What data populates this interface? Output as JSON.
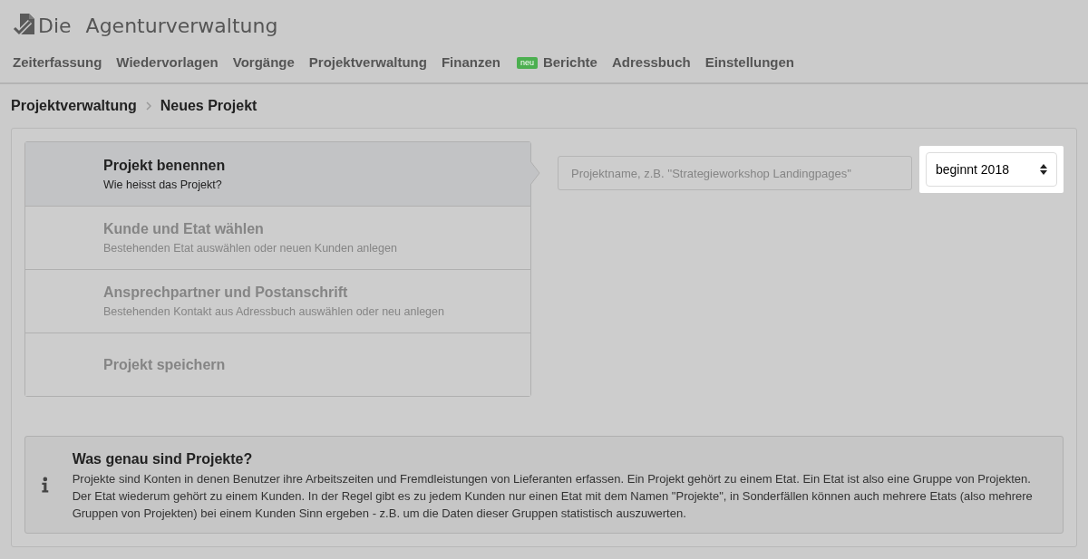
{
  "app": {
    "title_prefix": "Die",
    "title": "Agenturverwaltung"
  },
  "nav": [
    {
      "label": "Zeiterfassung"
    },
    {
      "label": "Wiedervorlagen"
    },
    {
      "label": "Vorgänge"
    },
    {
      "label": "Projektverwaltung"
    },
    {
      "label": "Finanzen"
    },
    {
      "label": "Berichte",
      "badge": "neu"
    },
    {
      "label": "Adressbuch"
    },
    {
      "label": "Einstellungen"
    }
  ],
  "breadcrumb": [
    "Projektverwaltung",
    "Neues Projekt"
  ],
  "steps": [
    {
      "title": "Projekt benennen",
      "subtitle": "Wie heisst das Projekt?",
      "selected": true
    },
    {
      "title": "Kunde und Etat wählen",
      "subtitle": "Bestehenden Etat auswählen oder neuen Kunden anlegen",
      "selected": false
    },
    {
      "title": "Ansprechpartner und Postanschrift",
      "subtitle": "Bestehenden Kontakt aus Adressbuch auswählen oder neu anlegen",
      "selected": false
    },
    {
      "title": "Projekt speichern",
      "selected": false
    }
  ],
  "name_field": {
    "placeholder": "Projektname, z.B. ''Strategieworkshop Landingpages''"
  },
  "year_select": {
    "value": "beginnt 2018"
  },
  "info": {
    "title": "Was genau sind Projekte?",
    "text": "Projekte sind Konten in denen Benutzer ihre Arbeitszeiten und Fremdleistungen von Lieferanten erfassen. Ein Projekt gehört zu einem Etat. Ein Etat ist also eine Gruppe von Projekten. Der Etat wiederum gehört zu einem Kunden. In der Regel gibt es zu jedem Kunden nur einen Etat mit dem Namen \"Projekte\", in Sonderfällen können auch mehrere Etats (also mehrere Gruppen von Projekten) bei einem Kunden Sinn ergeben - z.B. um die Daten dieser Gruppen statistisch auszuwerten."
  }
}
